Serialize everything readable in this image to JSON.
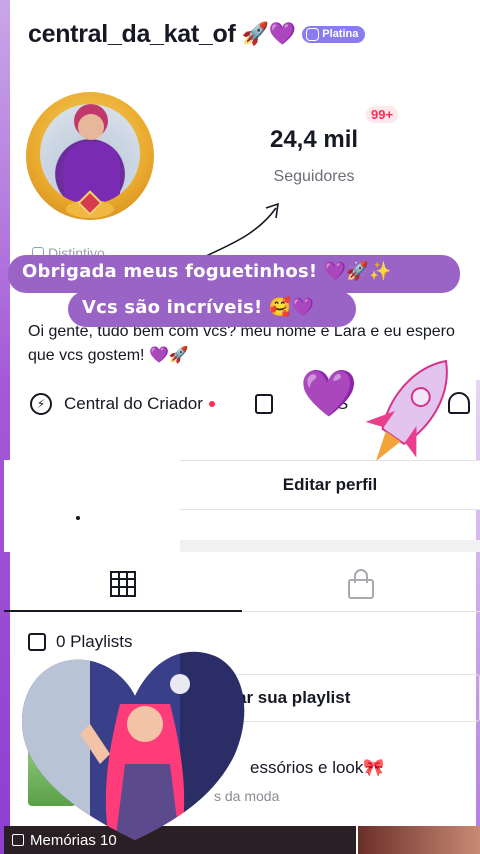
{
  "header": {
    "username": "central_da_kat_of",
    "emojis": "🚀💜",
    "badge": "Platina"
  },
  "stats": {
    "followers_value": "24,4 mil",
    "followers_label": "Seguidores",
    "notifications": "99+"
  },
  "distintivo": "Distintivo",
  "overlay": {
    "line1": "Obrigada meus foguetinhos! 💜🚀✨",
    "line2": "Vcs são incríveis! 🥰💜"
  },
  "bio": "Oi gente, tudo bem com vcs? meu nome é Lara e eu espero que vcs gostem! 💜🚀",
  "creator_row": {
    "creator_label": "Central do Criador",
    "shop_label": "ai S"
  },
  "buttons": {
    "edit_profile": "Editar perfil"
  },
  "playlists": {
    "label": "0 Playlists",
    "create": "ar sua playlist"
  },
  "accessories": {
    "title": "essórios e look🎀",
    "subtitle": "s da moda"
  },
  "memorias": "Memórias 10",
  "colors": {
    "accent": "#9a64c6",
    "badge": "#8a7cf0",
    "red": "#fe2c55"
  }
}
